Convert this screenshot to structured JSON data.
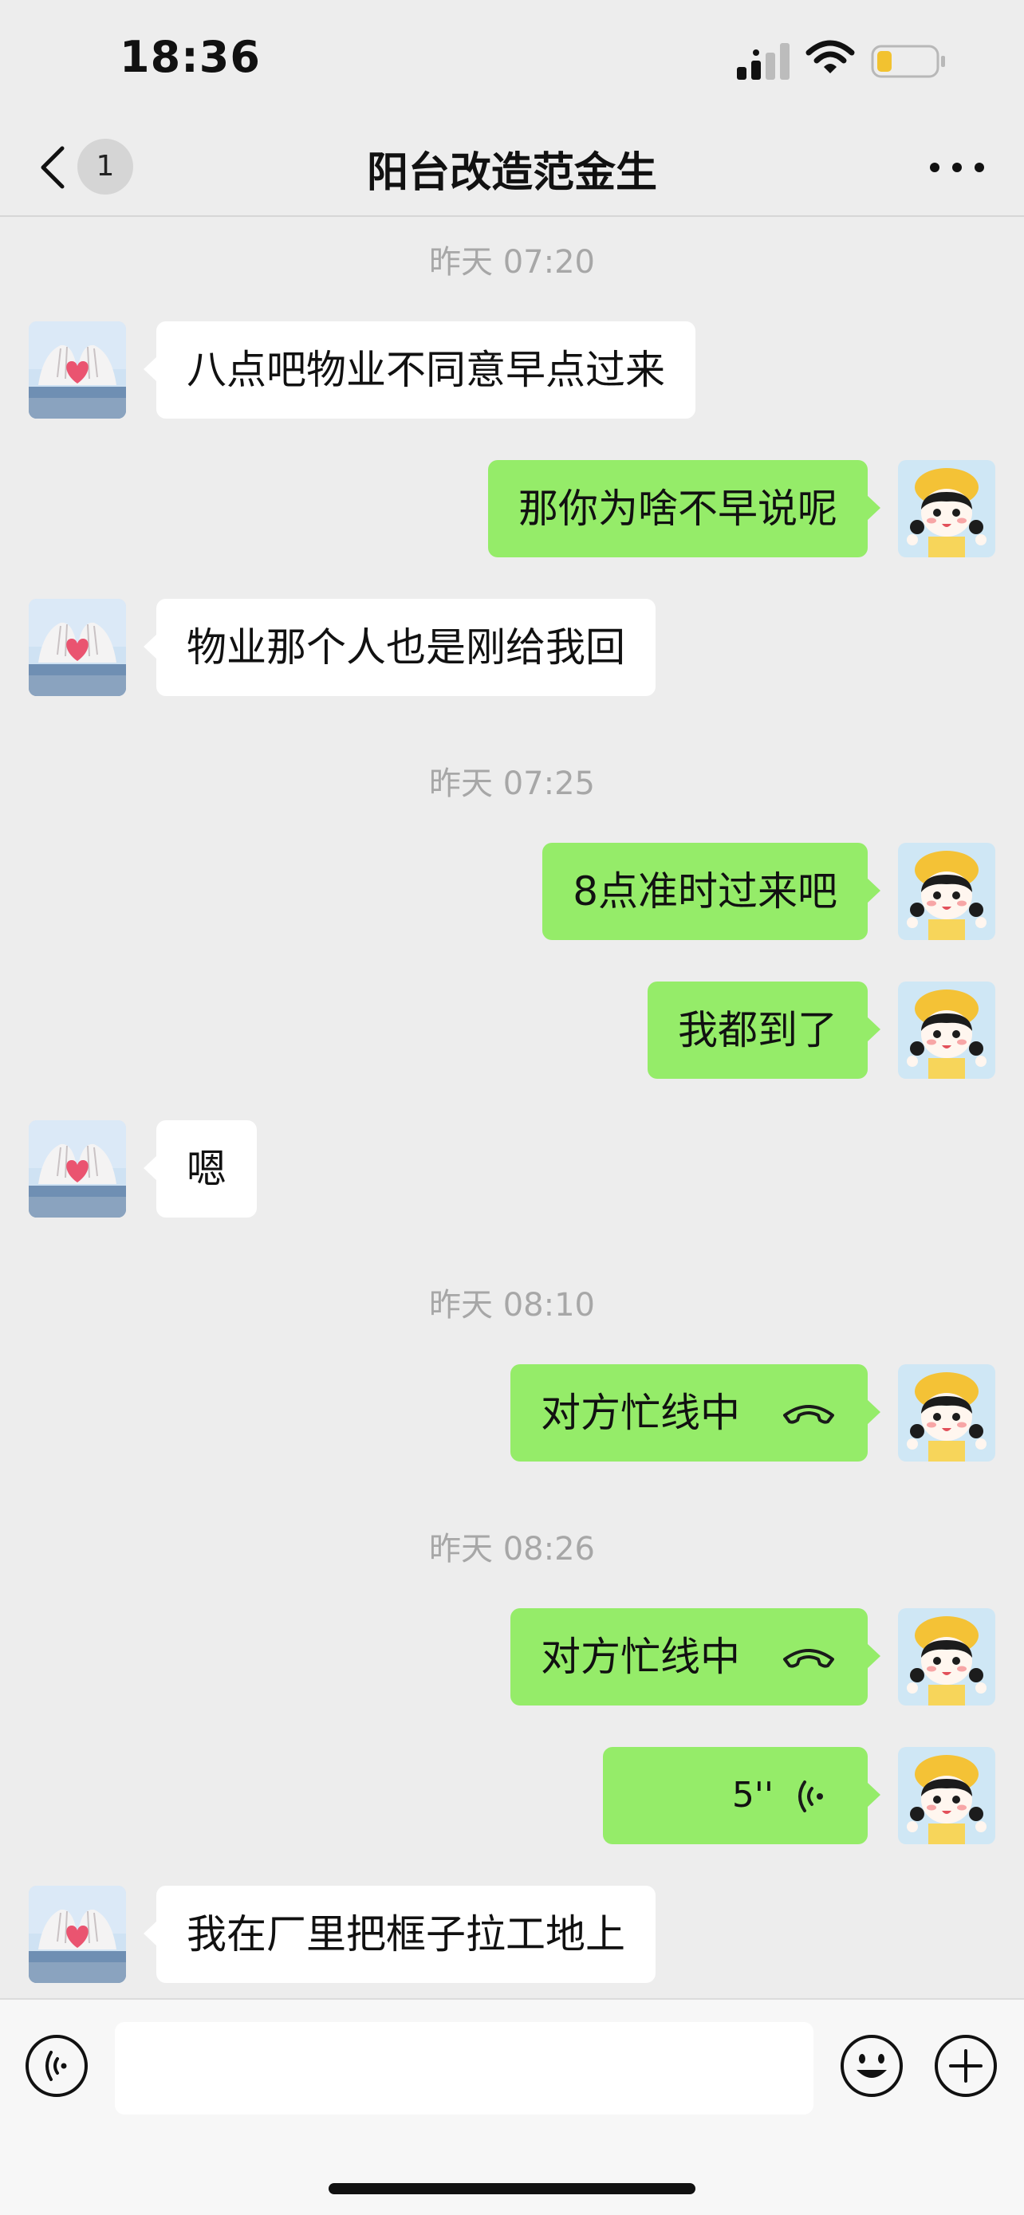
{
  "status_bar": {
    "time": "18:36",
    "icons": [
      "cellular-signal-icon",
      "wifi-icon",
      "battery-low-icon"
    ],
    "battery_color": "#f2c230"
  },
  "nav": {
    "back_icon": "chevron-left-icon",
    "unread_count": "1",
    "title": "阳台改造范金生",
    "more_icon": "more-dots-icon"
  },
  "colors": {
    "background": "#ededed",
    "outgoing_bubble": "#95ec69",
    "incoming_bubble": "#ffffff",
    "timestamp_text": "#a7a7a7"
  },
  "chat": {
    "ts1": "昨天 07:20",
    "m1": "八点吧物业不同意早点过来",
    "m2": "那你为啥不早说呢",
    "m3": "物业那个人也是刚给我回",
    "ts2": "昨天 07:25",
    "m4": "8点准时过来吧",
    "m5": "我都到了",
    "m6": "嗯",
    "ts3": "昨天 08:10",
    "m7": "对方忙线中",
    "ts4": "昨天 08:26",
    "m8": "对方忙线中",
    "m9_duration": "5''",
    "m10": "我在厂里把框子拉工地上"
  },
  "input_bar": {
    "voice_icon": "voice-toggle-icon",
    "emoji_icon": "emoji-icon",
    "plus_icon": "plus-icon",
    "placeholder": ""
  }
}
